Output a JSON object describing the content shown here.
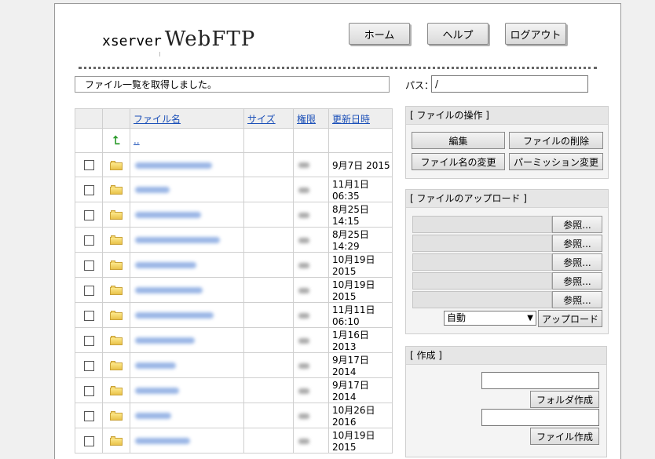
{
  "app": {
    "logo_small": "xserver",
    "logo_big": "WebFTP"
  },
  "nav": {
    "home": "ホーム",
    "help": "ヘルプ",
    "logout": "ログアウト"
  },
  "status_message": "ファイル一覧を取得しました。",
  "path": {
    "label": "パス：",
    "value": "/"
  },
  "file_table": {
    "columns": [
      "ファイル名",
      "サイズ",
      "権限",
      "更新日時"
    ],
    "parent_link": "..",
    "rows": [
      {
        "date": "9月7日 2015"
      },
      {
        "date": "11月1日 06:35"
      },
      {
        "date": "8月25日 14:15"
      },
      {
        "date": "8月25日 14:29"
      },
      {
        "date": "10月19日 2015"
      },
      {
        "date": "10月19日 2015"
      },
      {
        "date": "11月11日 06:10"
      },
      {
        "date": "1月16日 2013"
      },
      {
        "date": "9月17日 2014"
      },
      {
        "date": "9月17日 2014"
      },
      {
        "date": "10月26日 2016"
      },
      {
        "date": "10月19日 2015"
      }
    ]
  },
  "file_ops": {
    "title": "[ ファイルの操作 ]",
    "edit": "編集",
    "delete": "ファイルの削除",
    "rename": "ファイル名の変更",
    "permission": "パーミッション変更"
  },
  "upload": {
    "title": "[ ファイルのアップロード ]",
    "browse": "参照...",
    "mode_selected": "自動",
    "submit": "アップロード"
  },
  "create": {
    "title": "[ 作成 ]",
    "folder_button": "フォルダ作成",
    "file_button": "ファイル作成"
  }
}
